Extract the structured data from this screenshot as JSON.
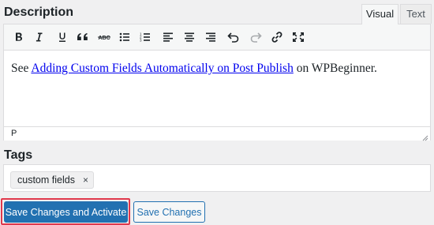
{
  "description": {
    "label": "Description",
    "tabs": [
      {
        "label": "Visual",
        "active": true
      },
      {
        "label": "Text",
        "active": false
      }
    ],
    "toolbar": [
      {
        "name": "bold-icon",
        "title": "Bold"
      },
      {
        "name": "italic-icon",
        "title": "Italic"
      },
      {
        "name": "underline-icon",
        "title": "Underline"
      },
      {
        "name": "blockquote-icon",
        "title": "Blockquote"
      },
      {
        "name": "strikethrough-icon",
        "title": "Strikethrough"
      },
      {
        "name": "bullet-list-icon",
        "title": "Bulleted list"
      },
      {
        "name": "numbered-list-icon",
        "title": "Numbered list"
      },
      {
        "name": "align-left-icon",
        "title": "Align left"
      },
      {
        "name": "align-center-icon",
        "title": "Align center"
      },
      {
        "name": "align-right-icon",
        "title": "Align right"
      },
      {
        "name": "undo-icon",
        "title": "Undo"
      },
      {
        "name": "redo-icon",
        "title": "Redo"
      },
      {
        "name": "link-icon",
        "title": "Insert/edit link"
      },
      {
        "name": "fullscreen-icon",
        "title": "Fullscreen"
      }
    ],
    "content": {
      "prefix": "See ",
      "link_text": "Adding Custom Fields Automatically on Post Publish",
      "suffix": " on WPBeginner."
    },
    "path": "P"
  },
  "tags": {
    "label": "Tags",
    "items": [
      {
        "label": "custom fields",
        "remove": "×"
      }
    ]
  },
  "actions": {
    "primary_label": "Save Changes and Activate",
    "secondary_label": "Save Changes"
  },
  "colors": {
    "primary": "#2271b1",
    "highlight": "#e0384c",
    "link": "#0000ee"
  }
}
